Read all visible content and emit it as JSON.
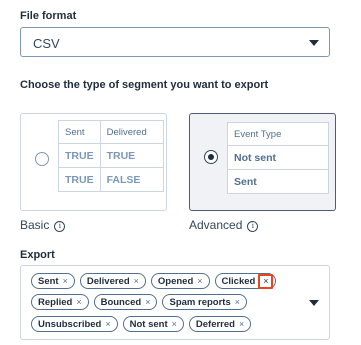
{
  "file_format": {
    "label": "File format",
    "value": "CSV",
    "caret_icon": "caret-down-icon"
  },
  "segment": {
    "label": "Choose the type of segment you want to export",
    "basic": {
      "caption": "Basic",
      "selected": false,
      "headers": [
        "Sent",
        "Delivered"
      ],
      "rows": [
        [
          "TRUE",
          "TRUE"
        ],
        [
          "TRUE",
          "FALSE"
        ]
      ]
    },
    "advanced": {
      "caption": "Advanced",
      "selected": true,
      "header": "Event Type",
      "rows": [
        "Not sent",
        "Sent"
      ]
    },
    "info_glyph": "i"
  },
  "export": {
    "label": "Export",
    "remove_glyph": "×",
    "tags_row1": [
      "Sent",
      "Delivered",
      "Opened",
      "Clicked"
    ],
    "tags_row2": [
      "Replied",
      "Bounced",
      "Spam reports"
    ],
    "tags_row3": [
      "Unsubscribed",
      "Not sent",
      "Deferred"
    ],
    "highlight_color": "#e8461c"
  }
}
